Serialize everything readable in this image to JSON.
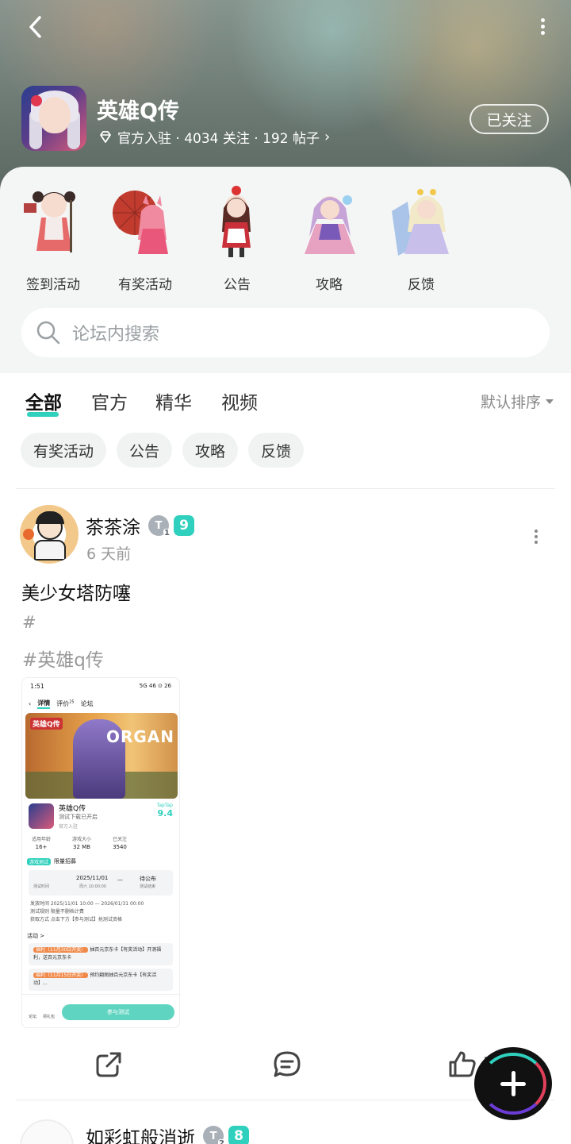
{
  "header": {
    "game_title": "英雄Q传",
    "meta_text": "官方入驻 · 4034 关注 · 192 帖子",
    "follow_label": "已关注"
  },
  "shortcuts": [
    {
      "label": "签到活动"
    },
    {
      "label": "有奖活动"
    },
    {
      "label": "公告"
    },
    {
      "label": "攻略"
    },
    {
      "label": "反馈"
    }
  ],
  "search": {
    "placeholder": "论坛内搜索"
  },
  "tabs": [
    {
      "label": "全部",
      "active": true
    },
    {
      "label": "官方",
      "active": false
    },
    {
      "label": "精华",
      "active": false
    },
    {
      "label": "视频",
      "active": false
    }
  ],
  "sort_label": "默认排序",
  "chips": [
    "有奖活动",
    "公告",
    "攻略",
    "反馈"
  ],
  "post": {
    "author": "茶茶涂",
    "badge_num": "1",
    "level": "9",
    "time": "6 天前",
    "title": "美少女塔防噻",
    "tag1": "#",
    "tag2": "#英雄q传",
    "like_count": "1",
    "screenshot": {
      "status_time": "1:51",
      "status_right": "5G 46 ⊙ 26",
      "nav_tabs": [
        "详情",
        "评价",
        "论坛"
      ],
      "nav_sup": "25",
      "banner_logo": "英雄Q传",
      "banner_text": "ORGAN",
      "app_name": "英雄Q传",
      "app_sub": "测试下载已开启",
      "app_official": "官方入驻",
      "score_label": "TapTap",
      "score_value": "9.4",
      "stats": [
        {
          "k": "适用年龄",
          "v": "16+"
        },
        {
          "k": "游戏大小",
          "v": "32 MB"
        },
        {
          "k": "已关注",
          "v": "3540"
        }
      ],
      "recruit_badge": "游戏测试",
      "recruit_text": "限量招募",
      "test_start": "2025/11/01",
      "test_start_sub": "周六 10:00:00",
      "test_end": "待公布",
      "test_end_sub": "测试结束",
      "test_label": "测试时间",
      "rules": [
        "发放时间   2025/11/01 10:00 — 2026/01/31 00:00",
        "测试规则   限量不删档计费",
        "获取方式   点击下方【参与测试】抢测试资格"
      ],
      "activity_header": "活动 >",
      "activities": [
        {
          "tag": "福利（11月30日开奖）",
          "text": "抽百元京东卡【有奖活动】开测福利，送百元京东卡"
        },
        {
          "tag": "福利（11月15日开奖）",
          "text": "预约翻图抽百元京东卡【有奖活动】..."
        }
      ],
      "join_label": "参与测试",
      "bottom_left1": "论坛",
      "bottom_left2": "领礼包"
    }
  },
  "next_post": {
    "author": "如彩虹般消逝",
    "badge_num": "2",
    "level": "8"
  }
}
